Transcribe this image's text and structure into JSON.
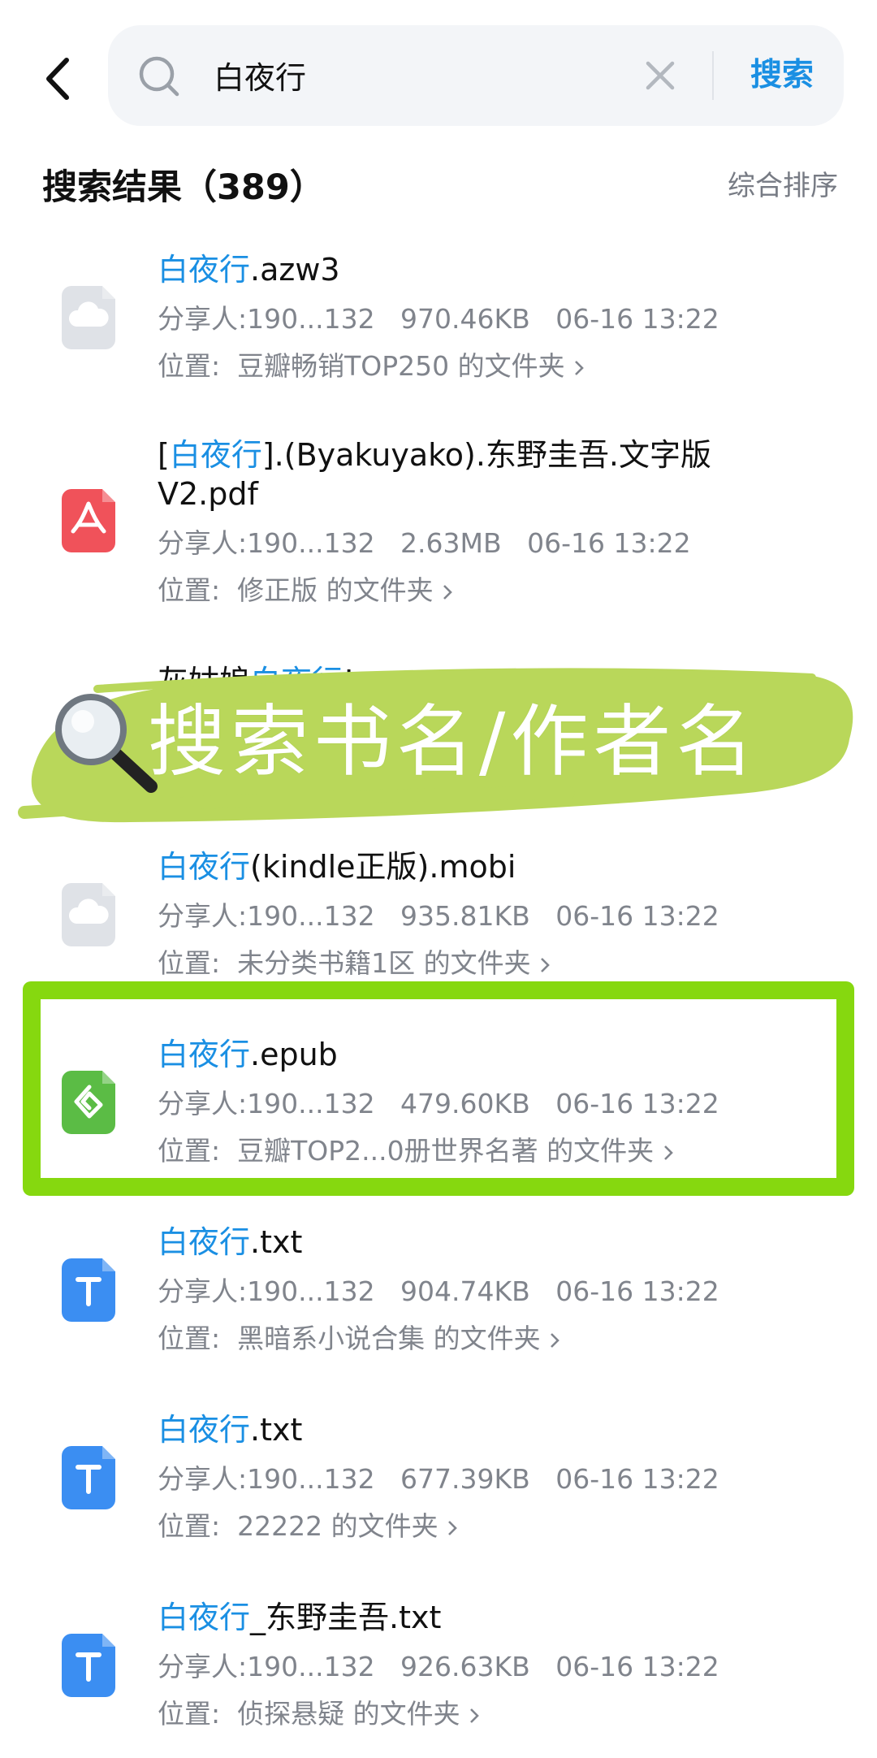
{
  "search": {
    "query": "白夜行",
    "submit_label": "搜索"
  },
  "results": {
    "title": "搜索结果（389）",
    "sort_label": "综合排序"
  },
  "partial_item": {
    "prefix": "灰姑娘",
    "highlight": "白夜行",
    "suffix": "!"
  },
  "promo": {
    "text": "搜索书名/作者名"
  },
  "items": [
    {
      "type": "cloud",
      "highlight": "白夜行",
      "before": "",
      "after": ".azw3",
      "sharer": "分享人:190...132",
      "size": "970.46KB",
      "time": "06-16 13:22",
      "location_prefix": "位置:",
      "folder": "豆瓣畅销TOP250 的文件夹"
    },
    {
      "type": "pdf",
      "highlight": "白夜行",
      "before": "[",
      "after": "].(Byakuyako).东野圭吾.文字版V2.pdf",
      "sharer": "分享人:190...132",
      "size": "2.63MB",
      "time": "06-16 13:22",
      "location_prefix": "位置:",
      "folder": "修正版 的文件夹"
    },
    {
      "type": "cloud",
      "highlight": "白夜行",
      "before": "",
      "after": "(kindle正版).mobi",
      "sharer": "分享人:190...132",
      "size": "935.81KB",
      "time": "06-16 13:22",
      "location_prefix": "位置:",
      "folder": "未分类书籍1区 的文件夹"
    },
    {
      "type": "epub",
      "highlight": "白夜行",
      "before": "",
      "after": ".epub",
      "sharer": "分享人:190...132",
      "size": "479.60KB",
      "time": "06-16 13:22",
      "location_prefix": "位置:",
      "folder": "豆瓣TOP2...0册世界名著 的文件夹"
    },
    {
      "type": "txt",
      "highlight": "白夜行",
      "before": "",
      "after": ".txt",
      "sharer": "分享人:190...132",
      "size": "904.74KB",
      "time": "06-16 13:22",
      "location_prefix": "位置:",
      "folder": "黑暗系小说合集 的文件夹"
    },
    {
      "type": "txt",
      "highlight": "白夜行",
      "before": "",
      "after": ".txt",
      "sharer": "分享人:190...132",
      "size": "677.39KB",
      "time": "06-16 13:22",
      "location_prefix": "位置:",
      "folder": "22222 的文件夹"
    },
    {
      "type": "txt",
      "highlight": "白夜行",
      "before": "",
      "after": "_东野圭吾.txt",
      "sharer": "分享人:190...132",
      "size": "926.63KB",
      "time": "06-16 13:22",
      "location_prefix": "位置:",
      "folder": "侦探悬疑 的文件夹"
    }
  ],
  "colors": {
    "accent": "#1a8fe3",
    "highlight_frame": "#86d80f",
    "promo_brush": "#b9d75a"
  }
}
